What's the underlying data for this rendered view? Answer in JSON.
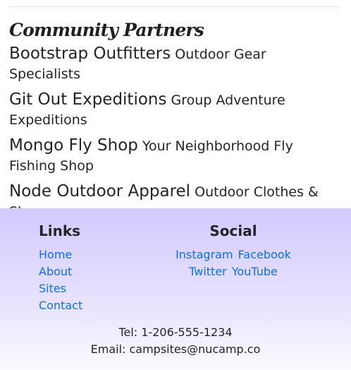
{
  "partners": {
    "title": "Community Partners",
    "items": [
      {
        "name": "Bootstrap Outfitters",
        "description": "Outdoor Gear Specialists"
      },
      {
        "name": "Git Out Expeditions",
        "description": "Group Adventure Expeditions"
      },
      {
        "name": "Mongo Fly Shop",
        "description": "Your Neighborhood Fly Fishing Shop"
      },
      {
        "name": "Node Outdoor Apparel",
        "description": "Outdoor Clothes & Shoes"
      }
    ]
  },
  "footer": {
    "links_title": "Links",
    "links": [
      "Home",
      "About",
      "Sites",
      "Contact"
    ],
    "social_title": "Social",
    "social": [
      "Instagram",
      "Facebook",
      "Twitter",
      "YouTube"
    ],
    "phone": "Tel: 1-206-555-1234",
    "email": "Email: campsites@nucamp.co"
  },
  "colors": {
    "link": "#0d6efd",
    "footer_gradient_top": "#d2cbff",
    "footer_gradient_bottom": "#fbfbff"
  }
}
